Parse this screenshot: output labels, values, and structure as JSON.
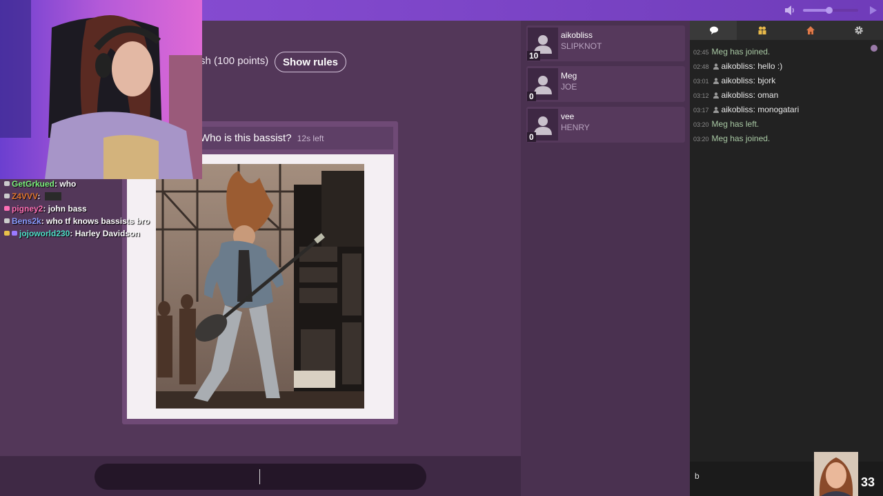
{
  "mode_line": "sh (100 points)",
  "show_rules_label": "Show rules",
  "question": {
    "text": "Who is this bassist?",
    "time_left": "12s left"
  },
  "answer_input": {
    "value": ""
  },
  "volume": {
    "level": 0.48
  },
  "players": [
    {
      "name": "aikobliss",
      "answer": "SLIPKNOT",
      "score": "10"
    },
    {
      "name": "Meg",
      "answer": "JOE",
      "score": "0"
    },
    {
      "name": "vee",
      "answer": "HENRY",
      "score": "0"
    }
  ],
  "chat": {
    "tabs": [
      {
        "icon": "speech-bubble-icon"
      },
      {
        "icon": "players-icon"
      },
      {
        "icon": "house-icon"
      },
      {
        "icon": "gear-icon"
      }
    ],
    "messages": [
      {
        "time": "02:45",
        "system": true,
        "text": "Meg has joined."
      },
      {
        "time": "02:48",
        "user": "aikobliss",
        "text": "hello :)"
      },
      {
        "time": "03:01",
        "user": "aikobliss",
        "text": "bjork"
      },
      {
        "time": "03:12",
        "user": "aikobliss",
        "text": "oman"
      },
      {
        "time": "03:17",
        "user": "aikobliss",
        "text": "monogatari"
      },
      {
        "time": "03:20",
        "system": true,
        "text": "Meg has left."
      },
      {
        "time": "03:20",
        "system": true,
        "text": "Meg has joined."
      }
    ],
    "input_value": "b"
  },
  "stream_chat": [
    {
      "user": "GetGrkued",
      "color": "#7cf27c",
      "text": "who"
    },
    {
      "user": "Z4VVV",
      "color": "#e0762e",
      "text": ""
    },
    {
      "user": "pigney2",
      "color": "#ff6fb5",
      "text": "john bass"
    },
    {
      "user": "Bens2k",
      "color": "#8a9cff",
      "text": "who tf knows bassists bro"
    },
    {
      "user": "jojoworld230",
      "color": "#4ee0c8",
      "text": "Harley Davidson"
    }
  ],
  "viewer_count": "33",
  "colors": {
    "topbar": "#8b4fd6",
    "main_bg": "#533759",
    "chat_bg": "#222222",
    "system_msg": "#a9c9a4"
  }
}
